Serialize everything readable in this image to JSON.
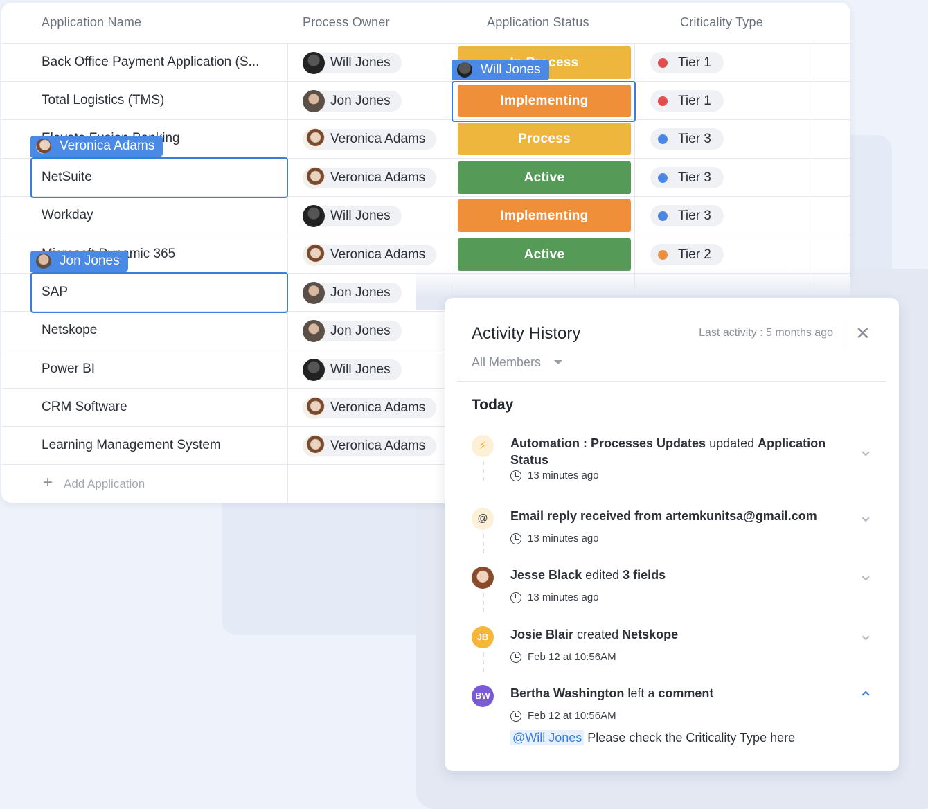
{
  "table": {
    "headers": [
      "Application Name",
      "Process Owner",
      "Application Status",
      "Criticality Type"
    ],
    "rows": [
      {
        "name": "Back Office Payment Application (S...",
        "owner": "Will Jones",
        "owner_av": "will",
        "status": "In Process",
        "status_color": "#eeb63d",
        "tier": "Tier 1",
        "tier_color": "#e24c4c"
      },
      {
        "name": "Total Logistics (TMS)",
        "owner": "Jon Jones",
        "owner_av": "jon",
        "status": "Implementing",
        "status_color": "#ef8f3a",
        "tier": "Tier 1",
        "tier_color": "#e24c4c"
      },
      {
        "name": "Elevate Fusion Banking",
        "owner": "Veronica Adams",
        "owner_av": "ver",
        "status": "Process",
        "status_color": "#eeb63d",
        "tier": "Tier 3",
        "tier_color": "#4a86e4"
      },
      {
        "name": "NetSuite",
        "owner": "Veronica Adams",
        "owner_av": "ver",
        "status": "Active",
        "status_color": "#559a57",
        "tier": "Tier 3",
        "tier_color": "#4a86e4"
      },
      {
        "name": "Workday",
        "owner": "Will Jones",
        "owner_av": "will",
        "status": "Implementing",
        "status_color": "#ef8f3a",
        "tier": "Tier 3",
        "tier_color": "#4a86e4"
      },
      {
        "name": "Microsoft Dynamic 365",
        "owner": "Veronica Adams",
        "owner_av": "ver",
        "status": "Active",
        "status_color": "#559a57",
        "tier": "Tier 2",
        "tier_color": "#ef8f3a"
      },
      {
        "name": "SAP",
        "owner": "Jon Jones",
        "owner_av": "jon",
        "status": "",
        "status_color": "",
        "tier": "",
        "tier_color": ""
      },
      {
        "name": "Netskope",
        "owner": "Jon Jones",
        "owner_av": "jon",
        "status": "",
        "status_color": "",
        "tier": "",
        "tier_color": ""
      },
      {
        "name": "Power BI",
        "owner": "Will Jones",
        "owner_av": "will",
        "status": "",
        "status_color": "",
        "tier": "",
        "tier_color": ""
      },
      {
        "name": "CRM Software",
        "owner": "Veronica Adams",
        "owner_av": "ver",
        "status": "",
        "status_color": "",
        "tier": "",
        "tier_color": ""
      },
      {
        "name": "Learning Management System",
        "owner": "Veronica Adams",
        "owner_av": "ver",
        "status": "",
        "status_color": "",
        "tier": "",
        "tier_color": ""
      }
    ],
    "add_label": "Add Application",
    "add_icon": "plus-icon"
  },
  "cursors": [
    {
      "name": "Will Jones",
      "av": "will"
    },
    {
      "name": "Veronica Adams",
      "av": "ver"
    },
    {
      "name": "Jon Jones",
      "av": "jon"
    }
  ],
  "panel": {
    "title": "Activity History",
    "filter": "All Members",
    "last_activity": "Last activity : 5 months ago",
    "section": "Today",
    "activities": [
      {
        "icon": "bolt-icon",
        "glyph": "⚡",
        "icon_bg": "#fdf0d6",
        "icon_color": "#f0a81a",
        "parts": [
          [
            "b",
            "Automation : Processes Updates"
          ],
          [
            "t",
            " updated "
          ],
          [
            "b",
            "Application Status"
          ]
        ],
        "time": "13 minutes ago",
        "expanded": false
      },
      {
        "icon": "at-icon",
        "glyph": "@",
        "icon_bg": "#fdf0d6",
        "icon_color": "#3a3f48",
        "parts": [
          [
            "b",
            "Email reply received from artemkunitsa@gmail.com"
          ]
        ],
        "time": "13 minutes ago",
        "expanded": false
      },
      {
        "icon": "avatar-jesse",
        "glyph": "",
        "icon_bg": "#c98b6b",
        "icon_color": "#fff",
        "parts": [
          [
            "b",
            "Jesse Black"
          ],
          [
            "t",
            " edited "
          ],
          [
            "b",
            "3 fields"
          ]
        ],
        "time": "13 minutes ago",
        "expanded": false
      },
      {
        "icon": "avatar-jb",
        "glyph": "JB",
        "icon_bg": "#f4b73a",
        "icon_color": "#fff",
        "parts": [
          [
            "b",
            "Josie Blair"
          ],
          [
            "t",
            " created "
          ],
          [
            "b",
            "Netskope"
          ]
        ],
        "time": "Feb 12 at 10:56AM",
        "expanded": false
      },
      {
        "icon": "avatar-bw",
        "glyph": "BW",
        "icon_bg": "#7a5ad6",
        "icon_color": "#fff",
        "parts": [
          [
            "b",
            "Bertha Washington"
          ],
          [
            "t",
            " left a "
          ],
          [
            "b",
            "comment"
          ]
        ],
        "time": "Feb 12 at 10:56AM",
        "expanded": true
      }
    ],
    "comment_mention": "@Will Jones",
    "comment_text": " Please check the Criticality Type here"
  }
}
